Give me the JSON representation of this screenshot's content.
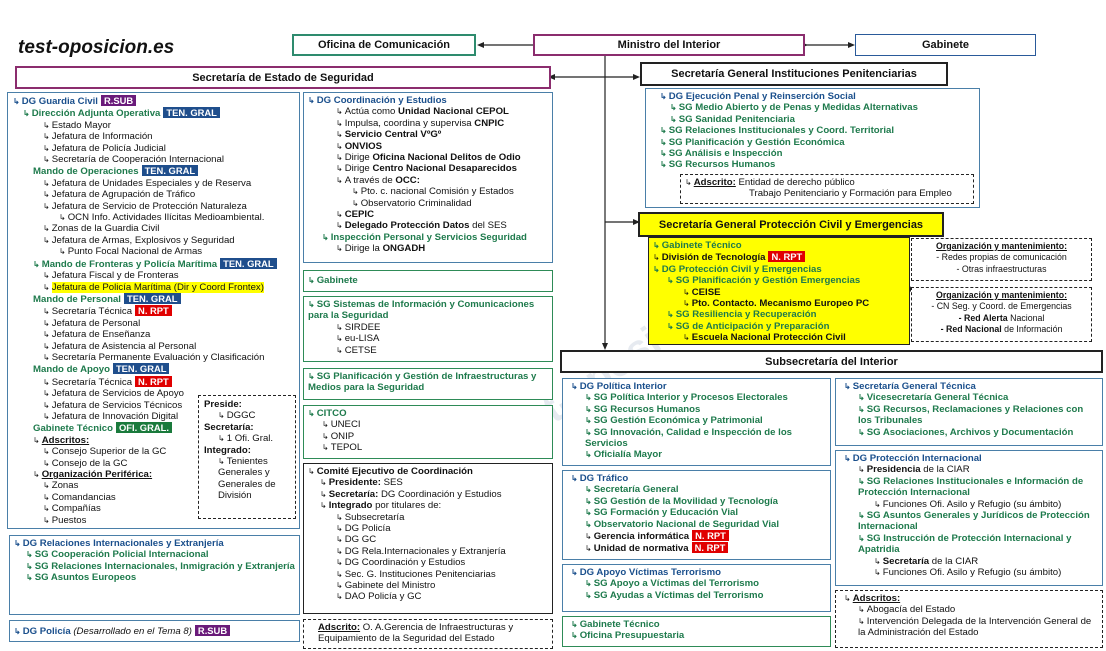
{
  "site": "test-oposicion.es",
  "top": {
    "ofc": "Oficina de Comunicación",
    "min": "Ministro del Interior",
    "gab": "Gabinete",
    "ses": "Secretaría de Estado de Seguridad",
    "sgip": "Secretaría General Instituciones Penitenciarias",
    "sgpc": "Secretaría General Protección Civil y Emergencias",
    "sub": "Subsecretaría del Interior"
  },
  "tags": {
    "rsub": "R.SUB",
    "tengral": "TEN. GRAL",
    "nrpt": "N. RPT",
    "ofigral": "OFI. GRAL."
  },
  "gc": {
    "title": "DG Guardia Civil",
    "dao": "Dirección Adjunta Operativa",
    "dao_items": [
      "Estado Mayor",
      "Jefatura de Información",
      "Jefatura de Policía Judicial",
      "Secretaría de Cooperación Internacional"
    ],
    "mop": "Mando de Operaciones",
    "mop_items": [
      "Jefatura de Unidades Especiales y de Reserva",
      "Jefatura de Agrupación de Tráfico",
      "Jefatura de Servicio de Protección Naturaleza"
    ],
    "ocn": "OCN Info. Actividades Ilícitas Medioambiental.",
    "mop_items2": [
      "Zonas de la Guardia Civil",
      "Jefatura de Armas, Explosivos y Seguridad"
    ],
    "pfna": "Punto Focal Nacional de Armas",
    "mfpm": "Mando de Fronteras y Policía Marítima",
    "mfpm_i1": "Jefatura Fiscal y de Fronteras",
    "mfpm_i2": "Jefatura de Policía Marítima (Dir y Coord Frontex)",
    "mp": "Mando de Personal",
    "mp_st": "Secretaría Técnica",
    "mp_items": [
      "Jefatura de Personal",
      "Jefatura de Enseñanza",
      "Jefatura de Asistencia al Personal",
      "Secretaría Permanente Evaluación y Clasificación"
    ],
    "ma": "Mando de Apoyo",
    "ma_st": "Secretaría Técnica",
    "ma_items": [
      "Jefatura de Servicios de Apoyo",
      "Jefatura de Servicios Técnicos",
      "Jefatura de Innovación Digital"
    ],
    "gt": "Gabinete Técnico",
    "ads": "Adscritos:",
    "ads_items": [
      "Consejo Superior de la GC",
      "Consejo de la GC"
    ],
    "op": "Organización Periférica:",
    "op_items": [
      "Zonas",
      "Comandancias",
      "Compañías",
      "Puestos"
    ],
    "pres": "Preside:",
    "pres_v": "DGGC",
    "sec": "Secretaría:",
    "sec_v": "1 Ofi. Gral.",
    "int": "Integrado:",
    "int_v": "Tenientes Generales y Generales de División"
  },
  "dgri": {
    "title": "DG Relaciones Internacionales y Extranjería",
    "items": [
      "SG Cooperación Policial Internacional",
      "SG Relaciones Internacionales, Inmigración y Extranjería",
      "SG Asuntos Europeos"
    ]
  },
  "dgp": {
    "title": "DG Policía",
    "note": "(Desarrollado en el Tema 8)"
  },
  "dgce": {
    "title": "DG Coordinación y Estudios",
    "i1p": "Actúa como ",
    "i1b": "Unidad Nacional CEPOL",
    "i2p": "Impulsa, coordina y supervisa ",
    "i2b": "CNPIC",
    "i3": "Servicio Central VºGº",
    "i4": "ONVIOS",
    "i5p": "Dirige ",
    "i5b": "Oficina Nacional Delitos de Odio",
    "i6p": "Dirige ",
    "i6b": "Centro Nacional Desaparecidos",
    "i7p": "A través de ",
    "i7b": "OCC:",
    "i7a": "Pto. c. nacional Comisión y Estados",
    "i7c": "Observatorio Criminalidad",
    "i8": "CEPIC",
    "i9b": "Delegado Protección Datos",
    "i9p": " del SES",
    "ipss": "Inspección Personal y Servicios Seguridad",
    "ongp": "Dirige la ",
    "ongb": "ONGADH"
  },
  "gab2": "Gabinete",
  "sgsi": {
    "title": "SG Sistemas de Información y Comunicaciones para la Seguridad",
    "items": [
      "SIRDEE",
      "eu-LISA",
      "CETSE"
    ]
  },
  "sgpg": "SG Planificación y Gestión de Infraestructuras y Medios para la Seguridad",
  "citco": {
    "title": "CITCO",
    "items": [
      "UNECI",
      "ONIP",
      "TEPOL"
    ]
  },
  "cec": {
    "title": "Comité Ejecutivo de Coordinación",
    "pres": "Presidente:",
    "pres_v": " SES",
    "sec": "Secretaría:",
    "sec_v": " DG Coordinación y Estudios",
    "int": "Integrado",
    "int_v": " por titulares de:",
    "items": [
      "Subsecretaría",
      "DG Policía",
      "DG GC",
      "DG Rela.Internacionales y Extranjería",
      "DG Coordinación y Estudios",
      "Sec. G. Instituciones Penitenciarias",
      "Gabinete del Ministro",
      "DAO Policía y GC"
    ]
  },
  "adsB": {
    "label": "Adscrito:",
    "text": " O. A.Gerencia de Infraestructuras y Equipamiento de la Seguridad del Estado"
  },
  "ip": {
    "title": "DG Ejecución Penal y Reinserción Social",
    "s1": "SG Medio Abierto y de Penas y Medidas Alternativas",
    "s2": "SG Sanidad Penitenciaria",
    "items": [
      "SG Relaciones Institucionales y Coord. Territorial",
      "SG Planificación y Gestión Económica",
      "SG Análisis e Inspección",
      "SG Recursos Humanos"
    ],
    "ads": "Adscrito:",
    "ads_v": " Entidad de derecho público",
    "ads_v2": "Trabajo Penitenciario y Formación para Empleo"
  },
  "pc": {
    "gt": "Gabinete Técnico",
    "dt": "División de Tecnología",
    "dgpce": "DG Protección Civil y Emergencias",
    "sgpge": "SG Planificación y Gestión Emergencias",
    "ceise": "CEISE",
    "pto": "Pto. Contacto. Mecanismo Europeo PC",
    "sgrr": "SG  Resiliencia y Recuperación",
    "sgap": "SG  de Anticipación y Preparación",
    "enpc": "Escuela Nacional Protección Civil"
  },
  "om1": {
    "title": "Organización y mantenimiento:",
    "l1": "- Redes propias de comunicación",
    "l2": "- Otras infraestructuras"
  },
  "om2": {
    "title": "Organización y mantenimiento:",
    "l1": "- CN Seg. y Coord. de Emergencias",
    "l2b": "- Red Alerta",
    "l2": " Nacional",
    "l3b": "- Red Nacional",
    "l3": " de Información"
  },
  "dgpi": {
    "title": "DG Política Interior",
    "items": [
      "SG Política Interior y Procesos Electorales",
      "SG Recursos Humanos",
      "SG Gestión Económica y Patrimonial",
      "SG  Innovación, Calidad e Inspección de los Servicios",
      "Oficialía Mayor"
    ]
  },
  "dgt": {
    "title": "DG Tráfico",
    "items": [
      "Secretaría General",
      "SG  Gestión de la Movilidad y Tecnología",
      "SG  Formación y Educación Vial",
      "Observatorio Nacional de Seguridad Vial"
    ],
    "gi": "Gerencia informática",
    "un": "Unidad de normativa"
  },
  "dgavt": {
    "title": "DG Apoyo Víctimas Terrorismo",
    "items": [
      "SG Apoyo a Víctimas del Terrorismo",
      "SG Ayudas a Víctimas del Terrorismo"
    ]
  },
  "gtof": {
    "items": [
      "Gabinete Técnico",
      "Oficina Presupuestaria"
    ]
  },
  "sgt": {
    "title": "Secretaría General Técnica",
    "items": [
      "Vicesecretaría General Técnica",
      "SG Recursos, Reclamaciones y Relaciones con los Tribunales",
      "SG Asociaciones, Archivos y Documentación"
    ]
  },
  "dgpint": {
    "title": "DG Protección Internacional",
    "presb": "Presidencia",
    "pres": " de la CIAR",
    "s1": "SG Relaciones Institucionales e Información de Protección Internacional",
    "f1": "Funciones Ofi. Asilo y Refugio (su ámbito)",
    "s2": "SG Asuntos Generales y Jurídicos de Protección Internacional",
    "s3": "SG Instrucción de Protección Internacional y Apatridia",
    "secb": "Secretaría",
    "sec": " de la CIAR",
    "f2": "Funciones Ofi. Asilo y Refugio (su ámbito)"
  },
  "adsS": {
    "label": "Adscritos:",
    "items": [
      "Abogacía del Estado",
      "Intervención Delegada de la Intervención General de la Administración del Estado"
    ]
  }
}
